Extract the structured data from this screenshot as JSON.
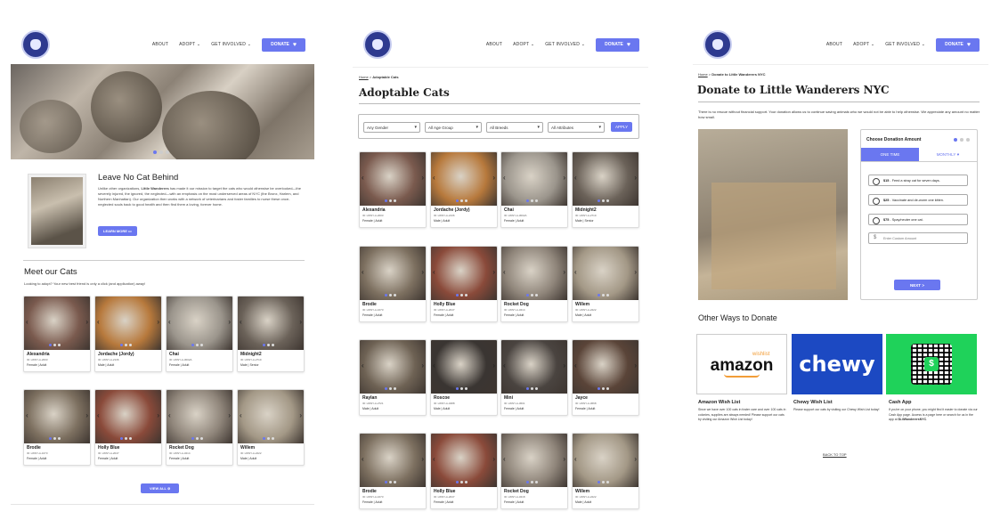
{
  "nav": {
    "about": "ABOUT",
    "adopt": "ADOPT ⌄",
    "get_involved": "GET INVOLVED ⌄",
    "donate": "DONATE"
  },
  "home": {
    "about_title": "Leave No Cat Behind",
    "about_text_1": "Unlike other organizations, ",
    "about_text_org": "Little Wanderers",
    "about_text_2": " has made it our mission to target the cats who would otherwise be overlooked—the severely injured, the ignored, the neglected—with an emphasis on the most underserved areas of NYC (the Bronx, Harlem, and Northern Manhattan). Our organization then works with a network of veterinarians and foster families to nurse these once-neglected souls back to good health and then find them a loving, forever home.",
    "learn_more": "LEARN MORE",
    "meet_title": "Meet our Cats",
    "meet_sub": "Looking to adopt? Your new best friend is only a click (and application) away!",
    "view_all": "VIEW ALL"
  },
  "adopt": {
    "breadcrumb_home": "Home",
    "breadcrumb_current": "Adoptable Cats",
    "title": "Adoptable Cats",
    "filters": [
      "Any Gender",
      "All Age Group",
      "All Breeds",
      "All Attributes"
    ],
    "apply": "APPLY"
  },
  "cats_home": [
    {
      "name": "Alexandria",
      "id": "ID: LWNY-A-2003",
      "info": "Female | Adult",
      "color": "#7a5a4e"
    },
    {
      "name": "Jordache (Jordy)",
      "id": "ID: LWNY-A-2136",
      "info": "Male | Adult",
      "color": "#b7793c"
    },
    {
      "name": "Chai",
      "id": "ID: LWNY-A-3002A",
      "info": "Female | Adult",
      "color": "#9b958c"
    },
    {
      "name": "Midnight2",
      "id": "ID: LWNY-A-2719",
      "info": "Male | Senior",
      "color": "#6b6259"
    },
    {
      "name": "Brodie",
      "id": "ID: LWNY-A-1673",
      "info": "Female | Adult",
      "color": "#7d7060"
    },
    {
      "name": "Holly Blue",
      "id": "ID: LWNY-A-2047",
      "info": "Female | Adult",
      "color": "#8a4a3a"
    },
    {
      "name": "Rocket Dog",
      "id": "ID: LWNY-A-3214",
      "info": "Female | Adult",
      "color": "#8f857a"
    },
    {
      "name": "Willem",
      "id": "ID: LWNY-A-2222",
      "info": "Male | Adult",
      "color": "#a39886"
    }
  ],
  "cats_adopt": [
    {
      "name": "Alexandria",
      "id": "ID: LWNY-A-2003",
      "info": "Female | Adult",
      "color": "#7a5a4e"
    },
    {
      "name": "Jordache (Jordy)",
      "id": "ID: LWNY-A-2136",
      "info": "Male | Adult",
      "color": "#b7793c"
    },
    {
      "name": "Chai",
      "id": "ID: LWNY-A-3002A",
      "info": "Female | Adult",
      "color": "#9b958c"
    },
    {
      "name": "Midnight2",
      "id": "ID: LWNY-A-2719",
      "info": "Male | Senior",
      "color": "#6b6259"
    },
    {
      "name": "Brodie",
      "id": "ID: LWNY-A-1673",
      "info": "Female | Adult",
      "color": "#7d7060"
    },
    {
      "name": "Holly Blue",
      "id": "ID: LWNY-A-2047",
      "info": "Female | Adult",
      "color": "#8a4a3a"
    },
    {
      "name": "Rocket Dog",
      "id": "ID: LWNY-A-3214",
      "info": "Female | Adult",
      "color": "#8f857a"
    },
    {
      "name": "Willem",
      "id": "ID: LWNY-A-2222",
      "info": "Male | Adult",
      "color": "#a39886"
    },
    {
      "name": "Raylan",
      "id": "ID: LWNY-A-2721",
      "info": "Male | Adult",
      "color": "#6e6254"
    },
    {
      "name": "Roscoe",
      "id": "ID: LWNY-A-3488",
      "info": "Male | Adult",
      "color": "#3a3532"
    },
    {
      "name": "Mini",
      "id": "ID: LWNY-A-3601",
      "info": "Female | Adult",
      "color": "#4a4440"
    },
    {
      "name": "Jayce",
      "id": "ID: LWNY-A-3668",
      "info": "Female | Adult",
      "color": "#5a4438"
    },
    {
      "name": "Brodie",
      "id": "ID: LWNY-A-1673",
      "info": "Female | Adult",
      "color": "#7d7060"
    },
    {
      "name": "Holly Blue",
      "id": "ID: LWNY-A-2047",
      "info": "Female | Adult",
      "color": "#8a4a3a"
    },
    {
      "name": "Rocket Dog",
      "id": "ID: LWNY-A-3218",
      "info": "Female | Adult",
      "color": "#8f857a"
    },
    {
      "name": "Willem",
      "id": "ID: LWNY-A-2222",
      "info": "Male | Adult",
      "color": "#a39886"
    }
  ],
  "donate": {
    "breadcrumb_home": "Home",
    "breadcrumb_current": "Donate to Little Wanderers NYC",
    "title": "Donate to Little Wanderers NYC",
    "intro": "There is no rescue without financial support. Your donation allows us to continue saving animals who we would not be able to help otherwise. We appreciate any amount no matter how small.",
    "choose_amount": "Choose Donation Amount",
    "tab_one_time": "ONE TIME",
    "tab_monthly": "MONTHLY",
    "option_1_amount": "$15",
    "option_1_text": " - Feed a stray cat for seven days.",
    "option_2_amount": "$25",
    "option_2_text": " - Vaccinate and de-worm one kitten.",
    "option_3_amount": "$75",
    "option_3_text": " - Spay/neuter one cat.",
    "currency_symbol": "$",
    "custom_placeholder": "Enter Custom Amount",
    "next": "NEXT",
    "other_ways_title": "Other Ways to Donate",
    "amazon_logo": "amazon",
    "amazon_wishlist_tag": "wishlist",
    "chewy_logo": "chewy",
    "amazon_name": "Amazon Wish List",
    "amazon_text": "Since we have over 100 cats in foster care and over 100 cats in colonies, supplies are always needed! Please support our cats by visiting our Amazon Wish List today!",
    "chewy_name": "Chewy Wish List",
    "chewy_text": "Please support our cats by visiting our Chewy Wish List today!",
    "cashapp_name": "Cash App",
    "cashapp_text_1": "If you're on your phone, you might find it easier to donate via our Cash App page. Access is a page here or search for us in the app at ",
    "cashapp_handle": "$LilWanderersNYC",
    "cashapp_text_2": ".",
    "back_to_top": "BACK TO TOP"
  },
  "colors": {
    "accent": "#6a77f0",
    "chewy": "#1c49c2",
    "cashapp": "#1fd25a"
  }
}
